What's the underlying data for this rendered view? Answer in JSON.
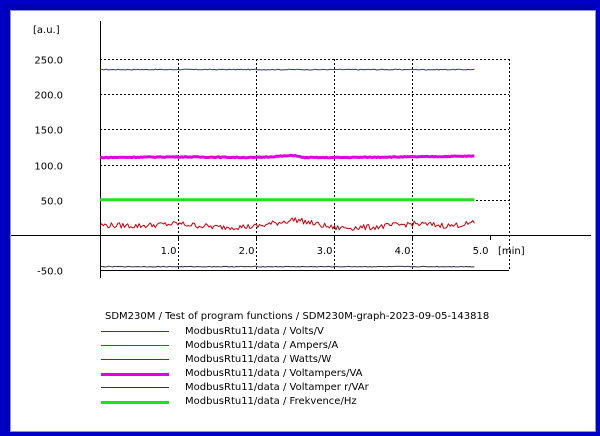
{
  "caption": "SDM230M / Test of program functions / SDM230M-graph-2023-09-05-143818",
  "chart_data": {
    "type": "line",
    "ylabel": "[a.u.]",
    "xlabel": "[min]",
    "xlim": [
      0,
      5.0
    ],
    "ylim": [
      -50,
      250
    ],
    "x_ticks": [
      "1.0",
      "2.0",
      "3.0",
      "4.0",
      "5.0"
    ],
    "y_ticks": [
      "250.0",
      "200.0",
      "150.0",
      "100.0",
      "50.0",
      "-50.0"
    ],
    "grid": true,
    "series": [
      {
        "name": "ModbusRtu11/data / Volts/V",
        "color": "#3030a0",
        "width": 1,
        "base": 235,
        "amp": 0.6,
        "x": [
          0,
          4.8
        ],
        "y": [
          235,
          235
        ]
      },
      {
        "name": "ModbusRtu11/data / Ampers/A",
        "color": "#008000",
        "width": 1,
        "base": 0,
        "amp": 0,
        "x": [
          0,
          4.8
        ],
        "y": [
          0,
          0
        ]
      },
      {
        "name": "ModbusRtu11/data / Watts/W",
        "color": "#c0000b",
        "width": 1,
        "base": 12,
        "amp": 4,
        "x": [
          0,
          0.5,
          1.0,
          1.5,
          2.0,
          2.5,
          3.0,
          3.5,
          4.0,
          4.5,
          4.8
        ],
        "y": [
          14,
          13,
          16,
          11,
          12,
          22,
          10,
          11,
          16,
          13,
          17
        ]
      },
      {
        "name": "ModbusRtu11/data / Voltampers/VA",
        "color": "#e000e0",
        "width": 3,
        "base": 110,
        "amp": 0.6,
        "x": [
          0,
          1.0,
          2.0,
          2.5,
          2.6,
          3.0,
          4.0,
          4.8
        ],
        "y": [
          110,
          111,
          110,
          113,
          110,
          110,
          111,
          112
        ]
      },
      {
        "name": "ModbusRtu11/data / Voltamper r/VAr",
        "color": "#303050",
        "width": 1,
        "base": -45,
        "amp": 0.5,
        "x": [
          0,
          4.8
        ],
        "y": [
          -45,
          -45
        ]
      },
      {
        "name": "ModbusRtu11/data / Frekvence/Hz",
        "color": "#20e020",
        "width": 3,
        "base": 50,
        "amp": 0,
        "x": [
          0,
          4.8
        ],
        "y": [
          50,
          50
        ]
      }
    ]
  }
}
